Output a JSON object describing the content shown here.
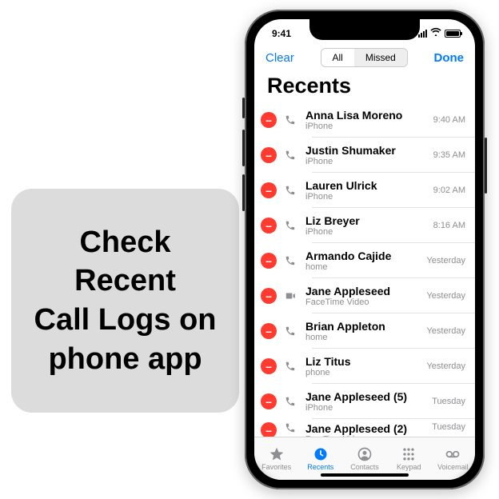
{
  "caption": "Check\nRecent\nCall Logs on\nphone app",
  "status": {
    "time": "9:41"
  },
  "nav": {
    "left": "Clear",
    "right": "Done",
    "seg_all": "All",
    "seg_missed": "Missed"
  },
  "title": "Recents",
  "calls": [
    {
      "name": "Anna Lisa Moreno",
      "sub": "iPhone",
      "time": "9:40 AM",
      "icon": "phone"
    },
    {
      "name": "Justin Shumaker",
      "sub": "iPhone",
      "time": "9:35 AM",
      "icon": "phone"
    },
    {
      "name": "Lauren Ulrick",
      "sub": "iPhone",
      "time": "9:02 AM",
      "icon": "phone"
    },
    {
      "name": "Liz Breyer",
      "sub": "iPhone",
      "time": "8:16 AM",
      "icon": "phone"
    },
    {
      "name": "Armando Cajide",
      "sub": "home",
      "time": "Yesterday",
      "icon": "phone"
    },
    {
      "name": "Jane Appleseed",
      "sub": "FaceTime Video",
      "time": "Yesterday",
      "icon": "video"
    },
    {
      "name": "Brian Appleton",
      "sub": "home",
      "time": "Yesterday",
      "icon": "phone"
    },
    {
      "name": "Liz Titus",
      "sub": "phone",
      "time": "Yesterday",
      "icon": "phone"
    },
    {
      "name": "Jane Appleseed (5)",
      "sub": "iPhone",
      "time": "Tuesday",
      "icon": "phone"
    },
    {
      "name": "Jane Appleseed (2)",
      "sub": "FaceTime Video",
      "time": "Tuesday",
      "icon": "phone"
    }
  ],
  "tabs": {
    "favorites": "Favorites",
    "recents": "Recents",
    "contacts": "Contacts",
    "keypad": "Keypad",
    "voicemail": "Voicemail"
  }
}
